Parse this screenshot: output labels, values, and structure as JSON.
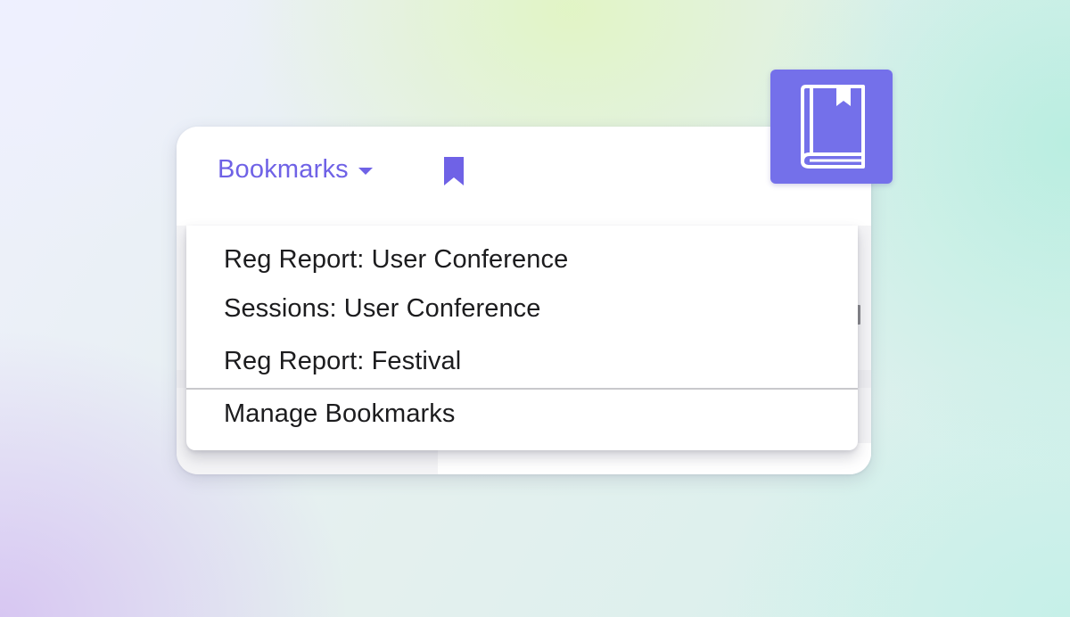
{
  "header": {
    "bookmarks_label": "Bookmarks",
    "bookmark_flag_icon": "bookmark-icon",
    "caret_icon": "caret-down-icon"
  },
  "menu": {
    "items": [
      {
        "label": "Reg Report: User Conference"
      },
      {
        "label": "Sessions: User Conference"
      },
      {
        "label": "Reg Report: Festival"
      }
    ],
    "manage_label": "Manage Bookmarks"
  },
  "badge": {
    "icon": "book-with-bookmark-icon"
  },
  "colors": {
    "accent": "#6f62e6",
    "badge_bg": "#7470ea",
    "menu_text": "#1c1c1e",
    "card_bg": "#ffffff"
  }
}
